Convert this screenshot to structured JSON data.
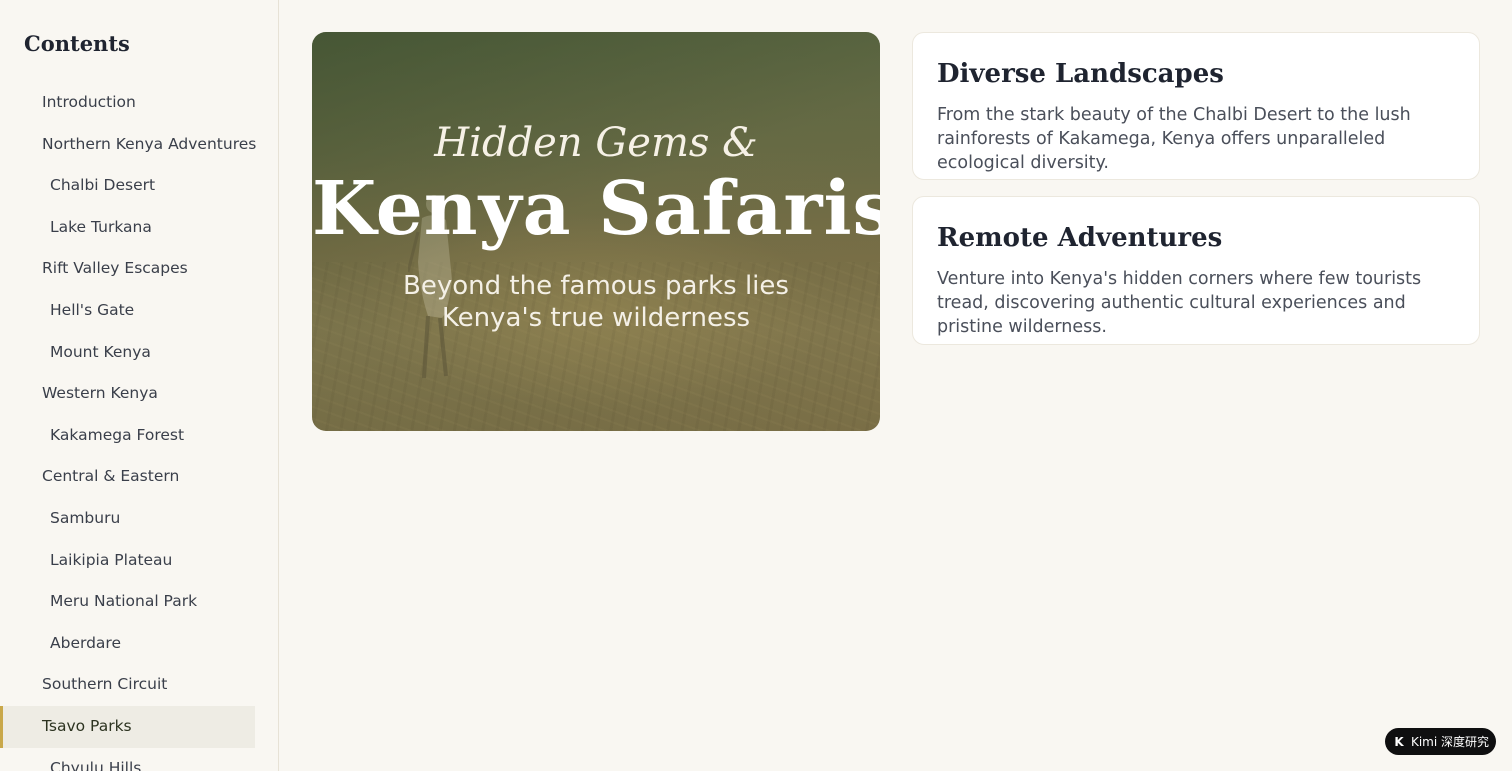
{
  "sidebar": {
    "title": "Contents",
    "items": [
      {
        "label": "Introduction"
      },
      {
        "label": "Northern Kenya Adventures"
      },
      {
        "label": "Chalbi Desert"
      },
      {
        "label": "Lake Turkana"
      },
      {
        "label": "Rift Valley Escapes"
      },
      {
        "label": "Hell's Gate"
      },
      {
        "label": "Mount Kenya"
      },
      {
        "label": "Western Kenya"
      },
      {
        "label": "Kakamega Forest"
      },
      {
        "label": "Central & Eastern"
      },
      {
        "label": "Samburu"
      },
      {
        "label": "Laikipia Plateau"
      },
      {
        "label": "Meru National Park"
      },
      {
        "label": "Aberdare"
      },
      {
        "label": "Southern Circuit"
      },
      {
        "label": "Tsavo Parks"
      },
      {
        "label": "Chyulu Hills"
      }
    ],
    "active_item": "Tsavo Parks"
  },
  "hero": {
    "eyebrow": "Hidden Gems &",
    "title": "Kenya Safaris",
    "subtitle": "Beyond the famous parks lies Kenya's true wilderness"
  },
  "cards": [
    {
      "title": "Diverse Landscapes",
      "body": "From the stark beauty of the Chalbi Desert to the lush rainforests of Kakamega, Kenya offers unparalleled ecological diversity."
    },
    {
      "title": "Remote Adventures",
      "body": "Venture into Kenya's hidden corners where few tourists tread, discovering authentic cultural experiences and pristine wilderness."
    }
  ],
  "badge": {
    "logo": "K",
    "label": "Kimi 深度研究"
  },
  "colors": {
    "accent": "#c9a84a",
    "page_bg": "#f9f7f2",
    "active_bg": "#eeece4"
  }
}
